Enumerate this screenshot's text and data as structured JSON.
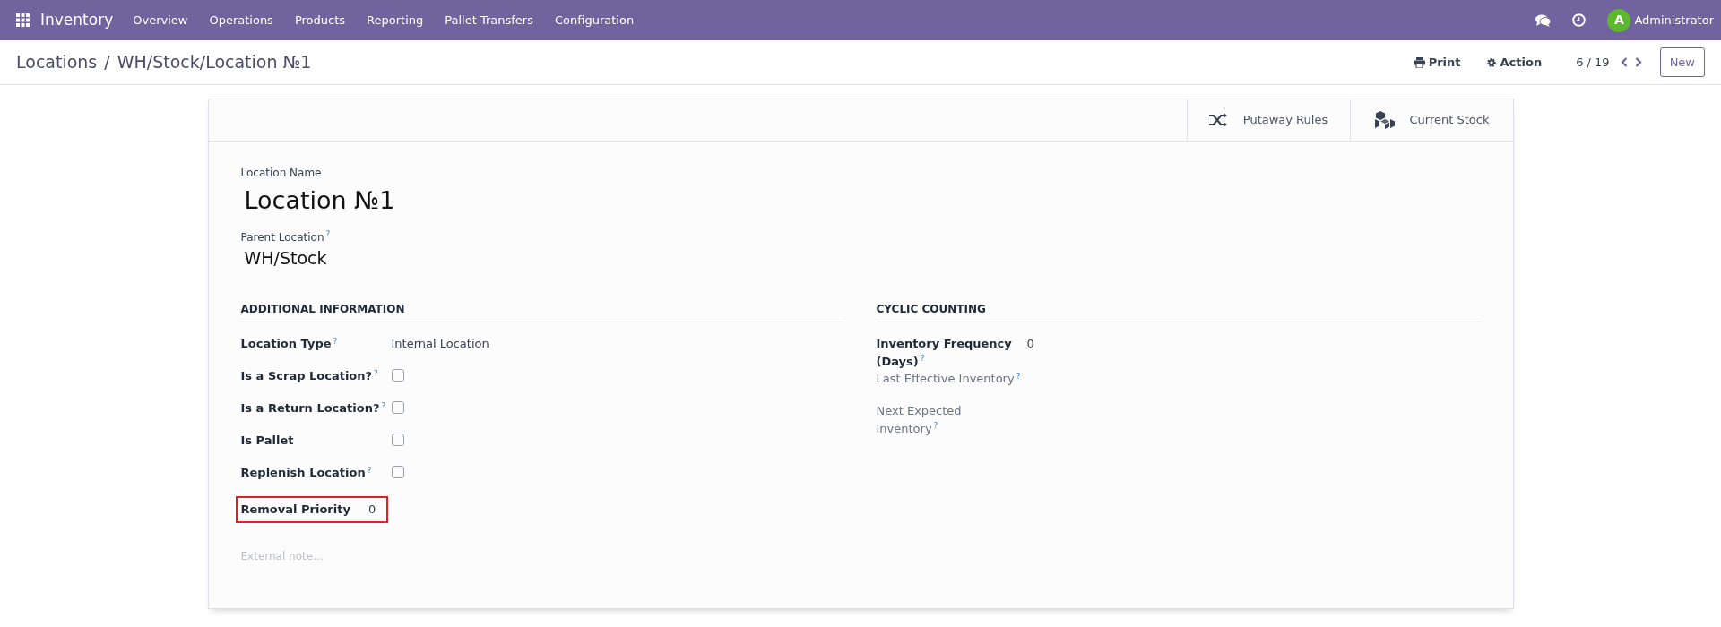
{
  "navbar": {
    "app_name": "Inventory",
    "menu": [
      "Overview",
      "Operations",
      "Products",
      "Reporting",
      "Pallet Transfers",
      "Configuration"
    ],
    "user": {
      "avatar_letter": "A",
      "name": "Administrator"
    }
  },
  "control_panel": {
    "breadcrumb": [
      "Locations",
      "WH/Stock/Location №1"
    ],
    "breadcrumb_separator": "/",
    "actions": [
      "Print",
      "Action"
    ],
    "pager": "6 / 19",
    "new_button": "New"
  },
  "smart_buttons": [
    "Putaway Rules",
    "Current Stock"
  ],
  "form": {
    "name_label": "Location Name",
    "name": "Location №1",
    "parent_label": "Parent Location",
    "parent_help": "?",
    "parent": "WH/Stock",
    "groups": [
      {
        "title": "ADDITIONAL INFORMATION",
        "fields": [
          {
            "label": "Location Type$^{?}$",
            "kind": "text",
            "value": "Internal Location"
          },
          {
            "label": "Is a Scrap Location?$^{?}$",
            "kind": "checkbox",
            "checked": false
          },
          {
            "label": "Is a Return Location?$^{?}$",
            "kind": "checkbox",
            "checked": false
          },
          {
            "label": "Is Pallet",
            "kind": "checkbox",
            "checked": false
          },
          {
            "label": "Replenish Location$^{?}$",
            "kind": "checkbox",
            "checked": false
          },
          {
            "label": "Removal Priority",
            "kind": "text",
            "value": "0",
            "highlighted": true
          }
        ]
      },
      {
        "title": "CYCLIC COUNTING",
        "fields": [
          {
            "label": "Inventory Frequency (Days)$^{?}$",
            "kind": "text",
            "value": "0"
          },
          {
            "label": "Last Effective Inventory$^{?}$",
            "kind": "text",
            "muted": true
          },
          {
            "label": "Next Expected Inventory$^{?}$",
            "kind": "text",
            "muted": true
          }
        ]
      }
    ],
    "note_placeholder": "External note..."
  }
}
